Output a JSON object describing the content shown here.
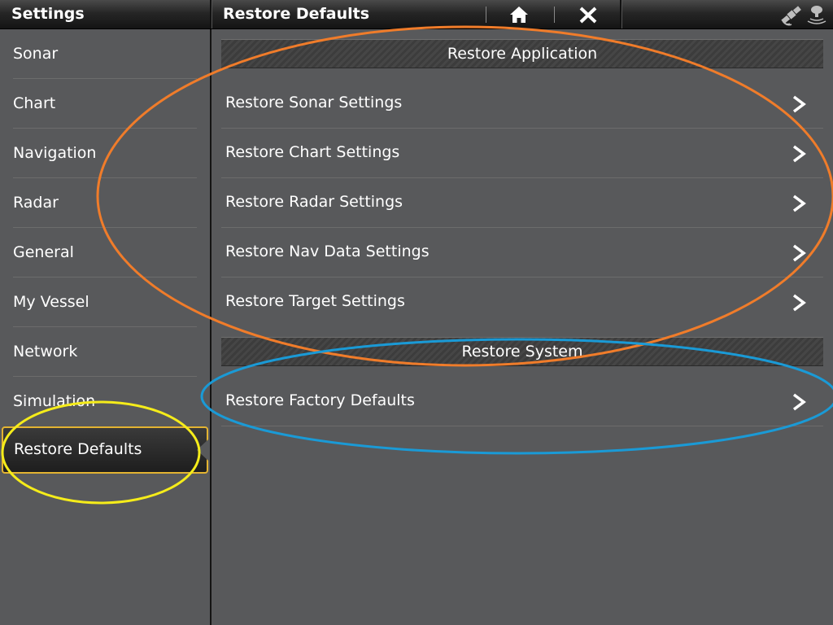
{
  "topbar": {
    "left_title": "Settings",
    "title": "Restore Defaults"
  },
  "icons": {
    "home": "home-icon",
    "close": "close-icon",
    "gps": "gps-satellite-icon",
    "sonar": "sonar-transducer-icon"
  },
  "sidebar": {
    "items": [
      {
        "label": "Sonar"
      },
      {
        "label": "Chart"
      },
      {
        "label": "Navigation"
      },
      {
        "label": "Radar"
      },
      {
        "label": "General"
      },
      {
        "label": "My Vessel"
      },
      {
        "label": "Network"
      },
      {
        "label": "Simulation"
      },
      {
        "label": "Restore Defaults",
        "selected": true
      }
    ]
  },
  "main": {
    "application": {
      "header": "Restore Application",
      "rows": [
        {
          "label": "Restore Sonar Settings"
        },
        {
          "label": "Restore Chart Settings"
        },
        {
          "label": "Restore Radar Settings"
        },
        {
          "label": "Restore Nav Data Settings"
        },
        {
          "label": "Restore Target Settings"
        }
      ]
    },
    "system": {
      "header": "Restore System",
      "rows": [
        {
          "label": "Restore Factory Defaults"
        }
      ]
    }
  },
  "colors": {
    "background": "#58595b",
    "selection_border": "#e3b332",
    "annotation_orange": "#f07c2a",
    "annotation_blue": "#1a9ad6",
    "annotation_yellow": "#f5ec1a"
  }
}
